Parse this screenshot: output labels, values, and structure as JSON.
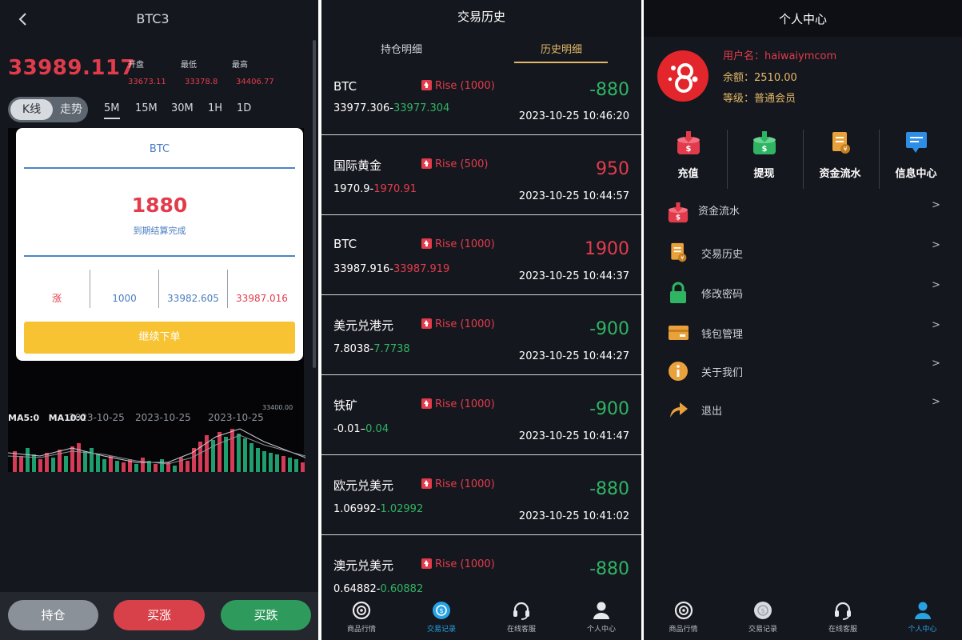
{
  "colors": {
    "accent_red": "#e23c4c",
    "accent_green": "#2fb464",
    "gold": "#e2b866",
    "active_blue": "#27a3e4",
    "panel_bg": "#15171e"
  },
  "chart_panel": {
    "title": "BTC3",
    "price": "33989.117",
    "stats": [
      {
        "label": "开盘",
        "value": "33673.11"
      },
      {
        "label": "最低",
        "value": "33378.8"
      },
      {
        "label": "最高",
        "value": "34406.77"
      }
    ],
    "toggle": {
      "active": "K线",
      "inactive": "走势"
    },
    "timeframes": [
      "5M",
      "15M",
      "30M",
      "1H",
      "1D"
    ],
    "active_timeframe": "5M",
    "chart_y_label": "33400.00",
    "x_labels": [
      "2023-10-25",
      "2023-10-25",
      "2023-10-25"
    ],
    "ma_labels": [
      "MA5:0",
      "MA10:0"
    ],
    "modal": {
      "title": "BTC",
      "amount": "1880",
      "subtitle": "到期结算完成",
      "columns": [
        {
          "text": "涨",
          "color": "#e23c4c"
        },
        {
          "text": "1000",
          "color": "#4a7ec0"
        },
        {
          "text": "33982.605",
          "color": "#4a7ec0"
        },
        {
          "text": "33987.016",
          "color": "#e23c4c"
        }
      ],
      "button": "继续下单"
    },
    "actions": {
      "hold": "持仓",
      "buy_up": "买涨",
      "buy_down": "买跌"
    }
  },
  "history_panel": {
    "title": "交易历史",
    "tabs": [
      {
        "label": "持仓明细",
        "active": false
      },
      {
        "label": "历史明细",
        "active": true
      }
    ],
    "trades": [
      {
        "name": "BTC",
        "direction": "Rise (1000)",
        "pnl": "-880",
        "pnl_color": "green",
        "open": "33977.306",
        "close": "33977.304",
        "close_color": "green",
        "time": "2023-10-25 10:46:20"
      },
      {
        "name": "国际黄金",
        "direction": "Rise (500)",
        "pnl": "950",
        "pnl_color": "red",
        "open": "1970.9",
        "close": "1970.91",
        "close_color": "red",
        "time": "2023-10-25 10:44:57"
      },
      {
        "name": "BTC",
        "direction": "Rise (1000)",
        "pnl": "1900",
        "pnl_color": "red",
        "open": "33987.916",
        "close": "33987.919",
        "close_color": "red",
        "time": "2023-10-25 10:44:37"
      },
      {
        "name": "美元兑港元",
        "direction": "Rise (1000)",
        "pnl": "-900",
        "pnl_color": "green",
        "open": "7.8038",
        "close": "7.7738",
        "close_color": "green",
        "time": "2023-10-25 10:44:27"
      },
      {
        "name": "铁矿",
        "direction": "Rise (1000)",
        "pnl": "-900",
        "pnl_color": "green",
        "open": "-0.01",
        "close": "0.04",
        "close_color": "green",
        "time": "2023-10-25 10:41:47"
      },
      {
        "name": "欧元兑美元",
        "direction": "Rise (1000)",
        "pnl": "-880",
        "pnl_color": "green",
        "open": "1.06992",
        "close": "1.02992",
        "close_color": "green",
        "time": "2023-10-25 10:41:02"
      },
      {
        "name": "澳元兑美元",
        "direction": "Rise (1000)",
        "pnl": "-880",
        "pnl_color": "green",
        "open": "0.64882",
        "close": "0.60882",
        "close_color": "green",
        "time": ""
      }
    ],
    "nav": [
      {
        "label": "商品行情",
        "icon": "market-icon",
        "active": false
      },
      {
        "label": "交易记录",
        "icon": "trade-record-icon",
        "active": true
      },
      {
        "label": "在线客服",
        "icon": "headset-icon",
        "active": false
      },
      {
        "label": "个人中心",
        "icon": "user-icon",
        "active": false
      }
    ]
  },
  "profile_panel": {
    "title": "个人中心",
    "username_label": "用户名：",
    "username": "haiwaiymcom",
    "balance_label": "余额：",
    "balance": "2510.00",
    "level_label": "等级：",
    "level": "普通会员",
    "quick_actions": [
      {
        "label": "充值",
        "icon": "deposit-icon"
      },
      {
        "label": "提现",
        "icon": "withdraw-icon"
      },
      {
        "label": "资金流水",
        "icon": "fund-flow-icon"
      },
      {
        "label": "信息中心",
        "icon": "message-icon"
      }
    ],
    "menu": [
      {
        "label": "资金流水",
        "icon": "fund-flow-icon"
      },
      {
        "label": "交易历史",
        "icon": "trade-history-icon"
      },
      {
        "label": "修改密码",
        "icon": "lock-icon"
      },
      {
        "label": "钱包管理",
        "icon": "wallet-icon"
      },
      {
        "label": "关于我们",
        "icon": "info-icon"
      },
      {
        "label": "退出",
        "icon": "logout-icon"
      }
    ],
    "menu_chevron": ">",
    "nav": [
      {
        "label": "商品行情",
        "icon": "market-icon",
        "active": false
      },
      {
        "label": "交易记录",
        "icon": "trade-record-icon",
        "active": false
      },
      {
        "label": "在线客服",
        "icon": "headset-icon",
        "active": false
      },
      {
        "label": "个人中心",
        "icon": "user-icon",
        "active": true
      }
    ]
  }
}
